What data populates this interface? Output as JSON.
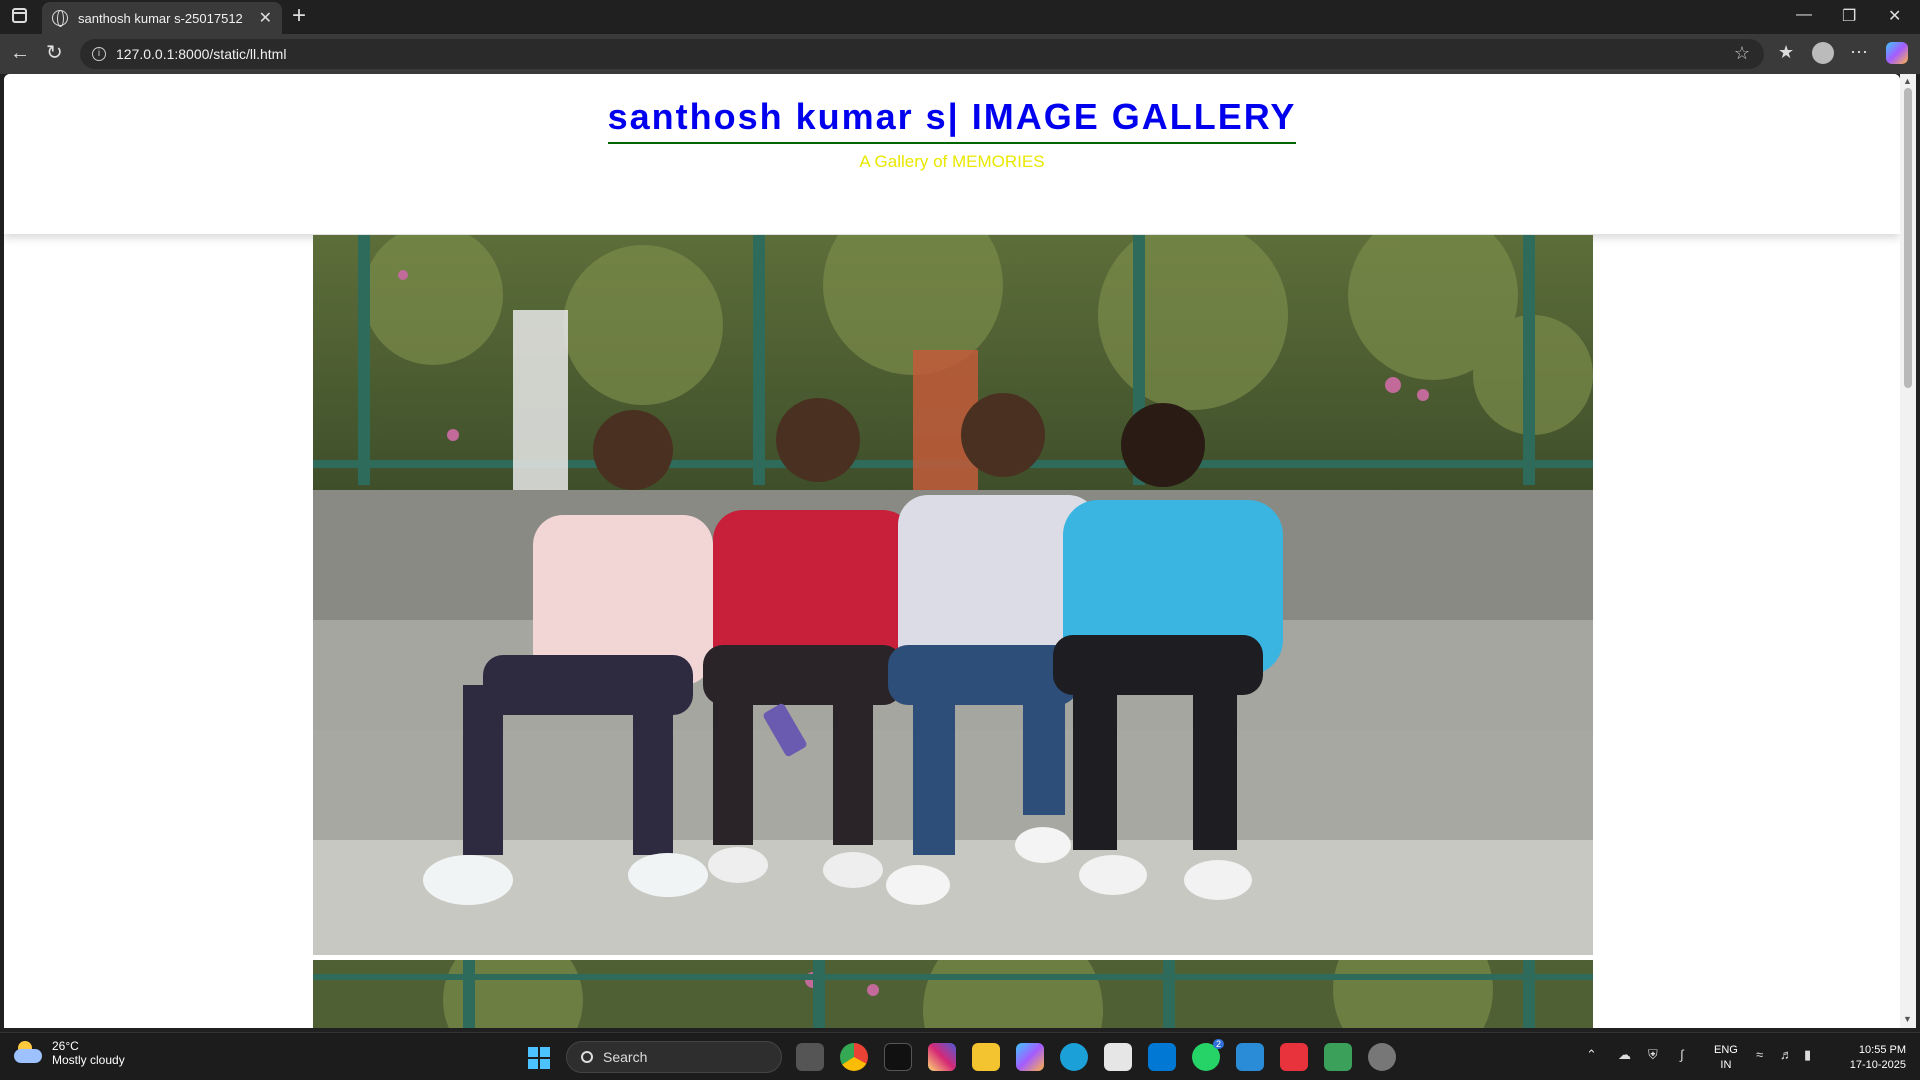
{
  "browser": {
    "tab_title": "santhosh kumar s-25017512",
    "tab_close": "✕",
    "new_tab": "+",
    "url": "127.0.0.1:8000/static/ll.html",
    "window_controls": {
      "minimize": "—",
      "restore": "❐",
      "close": "✕"
    }
  },
  "page": {
    "title": "santhosh kumar s| IMAGE GALLERY",
    "subtitle": "A Gallery of MEMORIES"
  },
  "colors": {
    "title": "#0000ee",
    "title_underline": "#006400",
    "subtitle": "#e8e800"
  },
  "taskbar": {
    "weather_temp": "26°C",
    "weather_desc": "Mostly cloudy",
    "search_label": "Search",
    "lang_line1": "ENG",
    "lang_line2": "IN",
    "time": "10:55 PM",
    "date": "17-10-2025",
    "whatsapp_badge": "2"
  }
}
